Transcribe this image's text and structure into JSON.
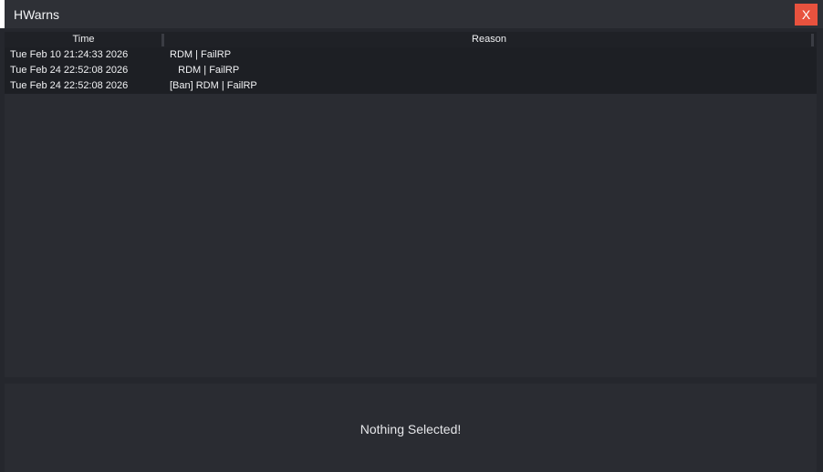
{
  "window": {
    "title": "HWarns",
    "close_label": "X"
  },
  "table": {
    "columns": [
      "Time",
      "Reason"
    ],
    "rows": [
      {
        "time": "Tue Feb 10 21:24:33 2026",
        "reason": "RDM | FailRP"
      },
      {
        "time": "Tue Feb 24 22:52:08 2026",
        "reason": "   RDM | FailRP"
      },
      {
        "time": "Tue Feb 24 22:52:08 2026",
        "reason": "[Ban] RDM | FailRP"
      }
    ]
  },
  "detail": {
    "text": "Nothing Selected!"
  },
  "colors": {
    "accent": "#e8523e",
    "background": "#25272d",
    "panel": "#2a2c32"
  }
}
